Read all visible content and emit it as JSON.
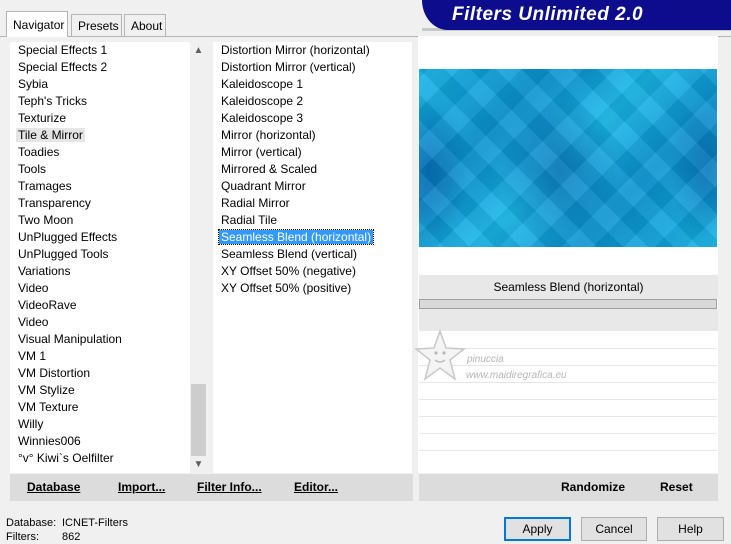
{
  "app": {
    "title": "Filters Unlimited 2.0"
  },
  "tabs": [
    {
      "label": "Navigator",
      "active": true
    },
    {
      "label": "Presets",
      "active": false
    },
    {
      "label": "About",
      "active": false
    }
  ],
  "categories": {
    "items": [
      "Special Effects 1",
      "Special Effects 2",
      "Sybia",
      "Teph's Tricks",
      "Texturize",
      "Tile & Mirror",
      "Toadies",
      "Tools",
      "Tramages",
      "Transparency",
      "Two Moon",
      "UnPlugged Effects",
      "UnPlugged Tools",
      "Variations",
      "Video",
      "VideoRave",
      "Video",
      "Visual Manipulation",
      "VM 1",
      "VM Distortion",
      "VM Stylize",
      "VM Texture",
      "Willy",
      "Winnies006",
      "°v° Kiwi`s Oelfilter"
    ],
    "selected": "Tile & Mirror"
  },
  "filters": {
    "items": [
      "Distortion Mirror (horizontal)",
      "Distortion Mirror (vertical)",
      "Kaleidoscope 1",
      "Kaleidoscope 2",
      "Kaleidoscope 3",
      "Mirror (horizontal)",
      "Mirror (vertical)",
      "Mirrored & Scaled",
      "Quadrant Mirror",
      "Radial Mirror",
      "Radial Tile",
      "Seamless Blend (horizontal)",
      "Seamless Blend (vertical)",
      "XY Offset 50% (negative)",
      "XY Offset 50% (positive)"
    ],
    "selected": "Seamless Blend (horizontal)"
  },
  "preview": {
    "filter_name": "Seamless Blend (horizontal)"
  },
  "watermark": {
    "line1": "pinuccia",
    "line2": "www.maidiregrafica.eu"
  },
  "left_buttons": {
    "database": "Database",
    "import": "Import...",
    "filter_info": "Filter Info...",
    "editor": "Editor..."
  },
  "right_buttons": {
    "randomize": "Randomize",
    "reset": "Reset"
  },
  "footer": {
    "database_label": "Database:",
    "database_value": "ICNET-Filters",
    "filters_label": "Filters:",
    "filters_value": "862",
    "apply": "Apply",
    "cancel": "Cancel",
    "help": "Help"
  },
  "colors": {
    "banner": "#0c0c8c",
    "selection": "#3399ff",
    "preview": "#0a93d1"
  }
}
